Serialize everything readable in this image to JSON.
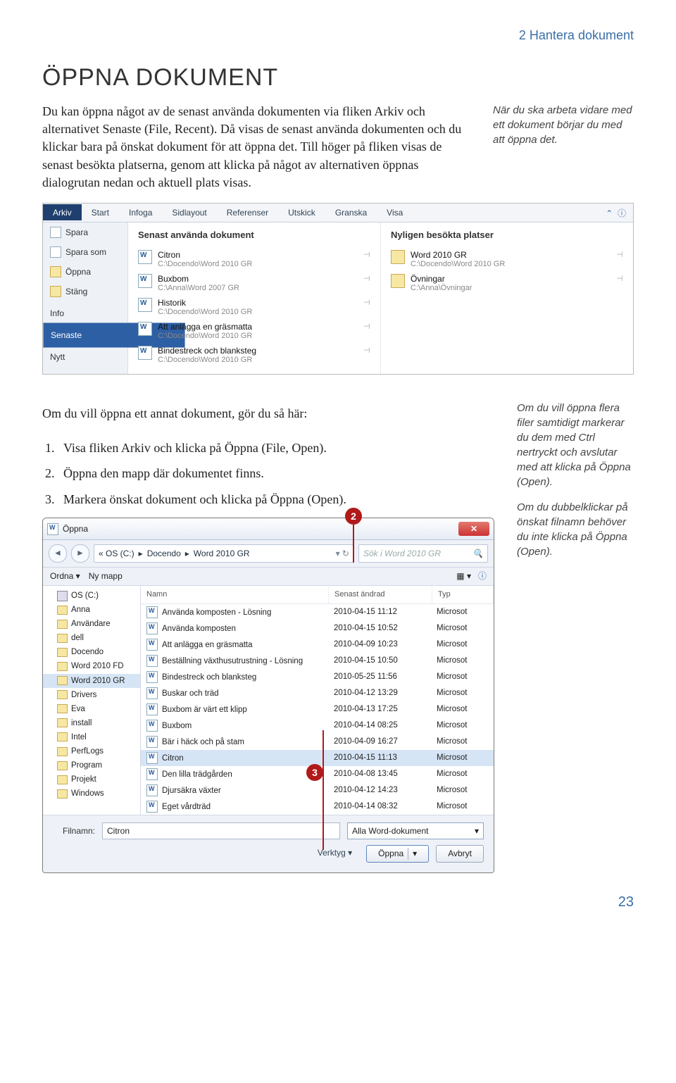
{
  "header": "2 Hantera dokument",
  "title": "ÖPPNA DOKUMENT",
  "para1": "Du kan öppna något av de senast använda dokumenten via fliken Arkiv och alternativet Senaste (File, Recent). Då visas de senast använda dokumenten och du klickar bara på önskat dokument för att öppna det. Till höger på fliken visas de senast besökta platserna, genom att klicka på något av alternativen öppnas dialogrutan nedan och aktuell plats visas.",
  "side1": "När du ska arbeta vidare med ett dokument börjar du med att öppna det.",
  "para2": "Om du vill öppna ett annat dokument, gör du så här:",
  "steps": [
    "Visa fliken Arkiv och klicka på Öppna (File, Open).",
    "Öppna den mapp där dokumentet finns.",
    "Markera önskat dokument och klicka på Öppna (Open)."
  ],
  "side2a": "Om du vill öppna flera filer samtidigt markerar du dem med Ctrl nertryckt och avslutar med att klicka på Öppna (Open).",
  "side2b": "Om du dubbelklickar på önskat filnamn behöver du inte klicka på Öppna (Open).",
  "ribbon": {
    "tabs": [
      "Arkiv",
      "Start",
      "Infoga",
      "Sidlayout",
      "Referenser",
      "Utskick",
      "Granska",
      "Visa"
    ]
  },
  "bsmenu": [
    "Spara",
    "Spara som",
    "Öppna",
    "Stäng",
    "Info",
    "Senaste",
    "Nytt"
  ],
  "recentDocsH": "Senast använda dokument",
  "recentPlacesH": "Nyligen besökta platser",
  "recentDocs": [
    {
      "n": "Citron",
      "p": "C:\\Docendo\\Word 2010 GR"
    },
    {
      "n": "Buxbom",
      "p": "C:\\Anna\\Word 2007 GR"
    },
    {
      "n": "Historik",
      "p": "C:\\Docendo\\Word 2010 GR"
    },
    {
      "n": "Att anlägga en gräsmatta",
      "p": "C:\\Docendo\\Word 2010 GR"
    },
    {
      "n": "Bindestreck och blanksteg",
      "p": "C:\\Docendo\\Word 2010 GR"
    }
  ],
  "recentPlaces": [
    {
      "n": "Word 2010 GR",
      "p": "C:\\Docendo\\Word 2010 GR"
    },
    {
      "n": "Övningar",
      "p": "C:\\Anna\\Övningar"
    }
  ],
  "dlg": {
    "title": "Öppna",
    "crumb": [
      "« OS (C:)",
      "Docendo",
      "Word 2010 GR"
    ],
    "searchPh": "Sök i Word 2010 GR",
    "toolbar": {
      "org": "Ordna ▾",
      "new": "Ny mapp"
    },
    "tree": [
      "OS (C:)",
      "Anna",
      "Användare",
      "dell",
      "Docendo",
      "Word 2010 FD",
      "Word 2010 GR",
      "Drivers",
      "Eva",
      "install",
      "Intel",
      "PerfLogs",
      "Program",
      "Projekt",
      "Windows"
    ],
    "cols": [
      "Namn",
      "Senast ändrad",
      "Typ"
    ],
    "rows": [
      {
        "n": "Använda komposten - Lösning",
        "d": "2010-04-15 11:12",
        "t": "Microsot"
      },
      {
        "n": "Använda komposten",
        "d": "2010-04-15 10:52",
        "t": "Microsot"
      },
      {
        "n": "Att anlägga en gräsmatta",
        "d": "2010-04-09 10:23",
        "t": "Microsot"
      },
      {
        "n": "Beställning växthusutrustning - Lösning",
        "d": "2010-04-15 10:50",
        "t": "Microsot"
      },
      {
        "n": "Bindestreck och blanksteg",
        "d": "2010-05-25 11:56",
        "t": "Microsot"
      },
      {
        "n": "Buskar och träd",
        "d": "2010-04-12 13:29",
        "t": "Microsot"
      },
      {
        "n": "Buxbom är värt ett klipp",
        "d": "2010-04-13 17:25",
        "t": "Microsot"
      },
      {
        "n": "Buxbom",
        "d": "2010-04-14 08:25",
        "t": "Microsot"
      },
      {
        "n": "Bär i häck och på stam",
        "d": "2010-04-09 16:27",
        "t": "Microsot"
      },
      {
        "n": "Citron",
        "d": "2010-04-15 11:13",
        "t": "Microsot",
        "sel": true
      },
      {
        "n": "Den lilla trädgården",
        "d": "2010-04-08 13:45",
        "t": "Microsot"
      },
      {
        "n": "Djursäkra växter",
        "d": "2010-04-12 14:23",
        "t": "Microsot"
      },
      {
        "n": "Eget vårdträd",
        "d": "2010-04-14 08:32",
        "t": "Microsot"
      }
    ],
    "fnLabel": "Filnamn:",
    "fnValue": "Citron",
    "filter": "Alla Word-dokument",
    "tools": "Verktyg ▾",
    "open": "Öppna",
    "cancel": "Avbryt"
  },
  "pagenum": "23"
}
